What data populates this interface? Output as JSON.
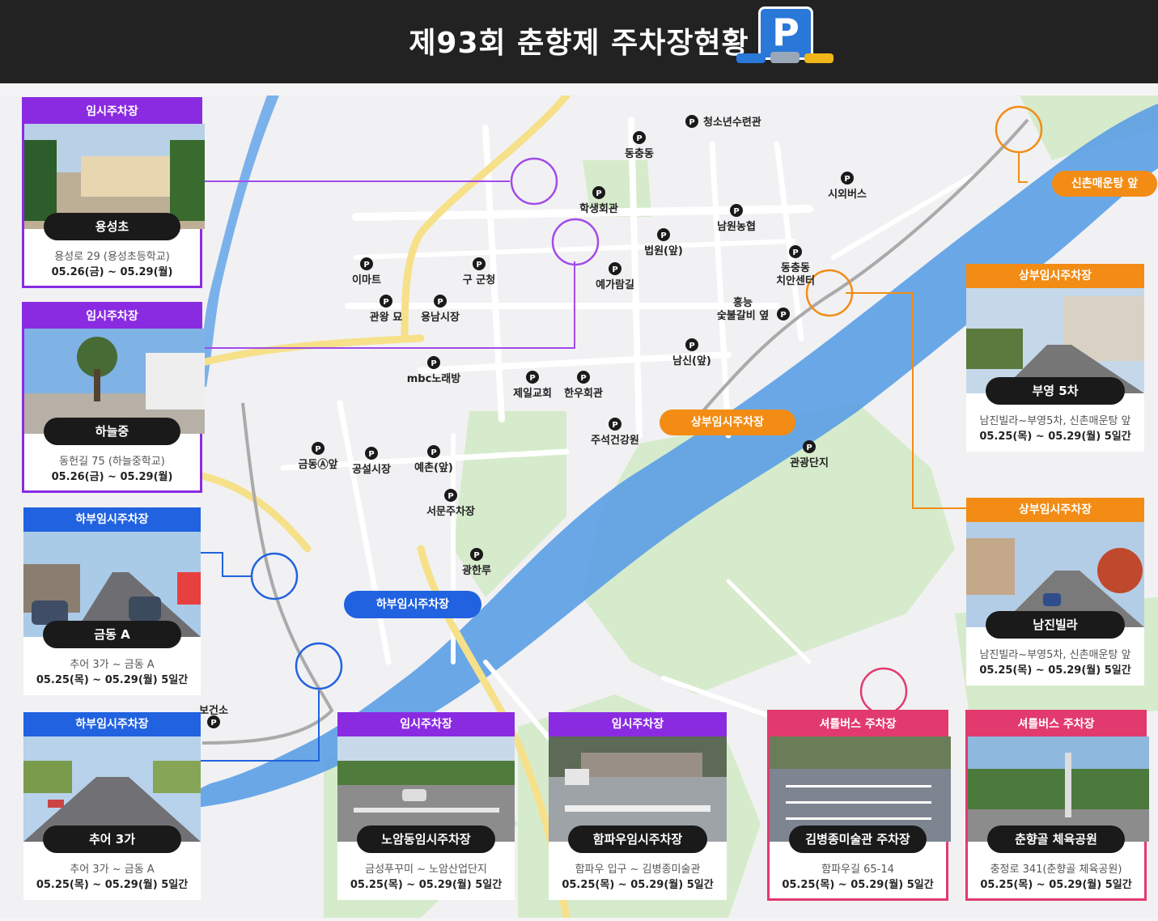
{
  "header": {
    "title": "제93회 춘향제 주차장현황",
    "parking_symbol": "P"
  },
  "colors": {
    "temp": "#8a2be2",
    "lower": "#2162e0",
    "upper": "#f28c14",
    "shuttle": "#e23a6e",
    "river": "#5b9ee6",
    "park": "#cfe6c4",
    "road": "#ffffff",
    "mainroad": "#f6e08a"
  },
  "map_labels": {
    "p1": "청소년수련관",
    "p2": "동충동",
    "p3": "학생회관",
    "p4": "남원농협",
    "p5": "시외버스",
    "p6": "이마트",
    "p7": "구 군청",
    "p8": "법원(앞)",
    "p9": "예가람길",
    "p10": "동충동 치안센터",
    "p11": "관왕 묘",
    "p12": "용남시장",
    "p13": "홍능 숯불갈비 옆",
    "p14": "남신(앞)",
    "p15": "mbc노래방",
    "p16": "제일교회",
    "p17": "한우회관",
    "p18": "주석건강원",
    "p19": "관광단지",
    "p20": "금동Ⓐ앞",
    "p21": "공설시장",
    "p22": "예촌(앞)",
    "p23": "서문주차장",
    "p24": "광한루",
    "p25": "보건소"
  },
  "tags": {
    "upper_center": "상부임시주차장",
    "upper_top": "신촌매운탕 앞",
    "lower_center": "하부임시주차장"
  },
  "cards": {
    "c1": {
      "head": "임시주차장",
      "name": "용성초",
      "addr": "용성로 29 (용성초등학교)",
      "date": "05.26(금) ~ 05.29(월)"
    },
    "c2": {
      "head": "임시주차장",
      "name": "하늘중",
      "addr": "동헌길 75 (하늘중학교)",
      "date": "05.26(금) ~ 05.29(월)"
    },
    "c3": {
      "head": "하부임시주차장",
      "name": "금동 A",
      "addr": "추어 3가 ~ 금동 A",
      "date": "05.25(목) ~ 05.29(월) 5일간"
    },
    "c4": {
      "head": "하부임시주차장",
      "name": "추어 3가",
      "addr": "추어 3가 ~ 금동 A",
      "date": "05.25(목) ~ 05.29(월) 5일간"
    },
    "c5": {
      "head": "임시주차장",
      "name": "노암동임시주차장",
      "addr": "금성푸꾸미 ~ 노암산업단지",
      "date": "05.25(목) ~ 05.29(월) 5일간"
    },
    "c6": {
      "head": "임시주차장",
      "name": "함파우임시주차장",
      "addr": "함파우 입구 ~ 김병종미술관",
      "date": "05.25(목) ~ 05.29(월) 5일간"
    },
    "c7": {
      "head": "셔틀버스 주차장",
      "name": "김병종미술관 주차장",
      "addr": "함파우길 65-14",
      "date": "05.25(목) ~ 05.29(월) 5일간"
    },
    "c8": {
      "head": "셔틀버스 주차장",
      "name": "춘향골 체육공원",
      "addr": "충정로 341(춘향골 체육공원)",
      "date": "05.25(목) ~ 05.29(월) 5일간"
    },
    "c9": {
      "head": "상부임시주차장",
      "name": "부영 5차",
      "addr": "남진빌라~부영5차, 신촌매운탕 앞",
      "date": "05.25(목) ~ 05.29(월) 5일간"
    },
    "c10": {
      "head": "상부임시주차장",
      "name": "남진빌라",
      "addr": "남진빌라~부영5차, 신촌매운탕 앞",
      "date": "05.25(목) ~ 05.29(월) 5일간"
    }
  }
}
